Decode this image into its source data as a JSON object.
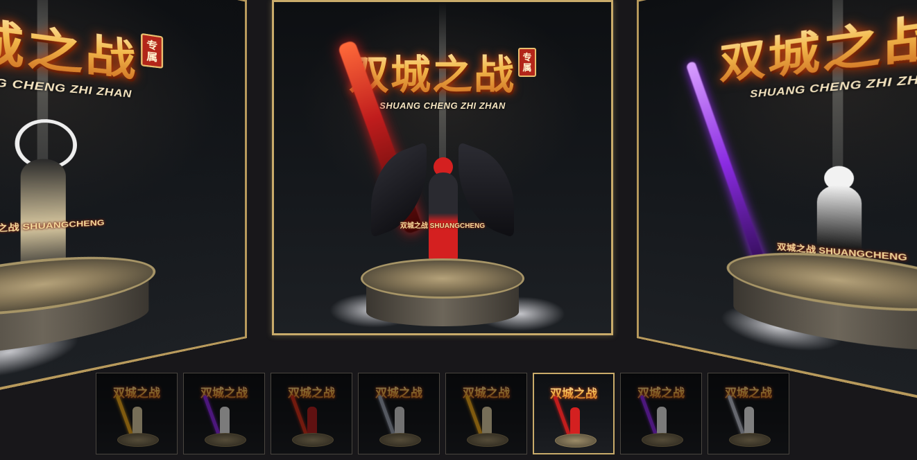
{
  "logo": {
    "title": "双城之战",
    "tag": "专属",
    "subtitle": "SHUANG CHENG ZHI ZHAN"
  },
  "cards": {
    "left": {
      "nametag": "双城之战 SHUANGCHENG",
      "weapon_color": "#e7a51c",
      "accent": "#f0d070"
    },
    "center": {
      "nametag": "双城之战 SHUANGCHENG",
      "weapon_color": "#c01d1d",
      "accent": "#d42020"
    },
    "right": {
      "nametag": "双城之战 SHUANGCHENG",
      "weapon_color": "#8a2be2",
      "accent": "#f2f2f2"
    }
  },
  "thumbnails": [
    {
      "logo": "双城之战",
      "weapon_color": "#e7a51c",
      "figure_color": "#d8c8a0",
      "active": false
    },
    {
      "logo": "双城之战",
      "weapon_color": "#8a2be2",
      "figure_color": "#e0e0e0",
      "active": false
    },
    {
      "logo": "双城之战",
      "weapon_color": "#d0301a",
      "figure_color": "#b02020",
      "active": false
    },
    {
      "logo": "双城之战",
      "weapon_color": "#9aa0b0",
      "figure_color": "#d0d0d0",
      "active": false
    },
    {
      "logo": "双城之战",
      "weapon_color": "#e7a51c",
      "figure_color": "#d8c8a0",
      "active": false
    },
    {
      "logo": "双城之战",
      "weapon_color": "#c01d1d",
      "figure_color": "#d42020",
      "active": true
    },
    {
      "logo": "双城之战",
      "weapon_color": "#8a2be2",
      "figure_color": "#e0e0e0",
      "active": false
    },
    {
      "logo": "双城之战",
      "weapon_color": "#b8bcc8",
      "figure_color": "#e8e8e8",
      "active": false
    }
  ],
  "colors": {
    "frame_gold": "#c9ab6a",
    "background": "#18171a"
  }
}
